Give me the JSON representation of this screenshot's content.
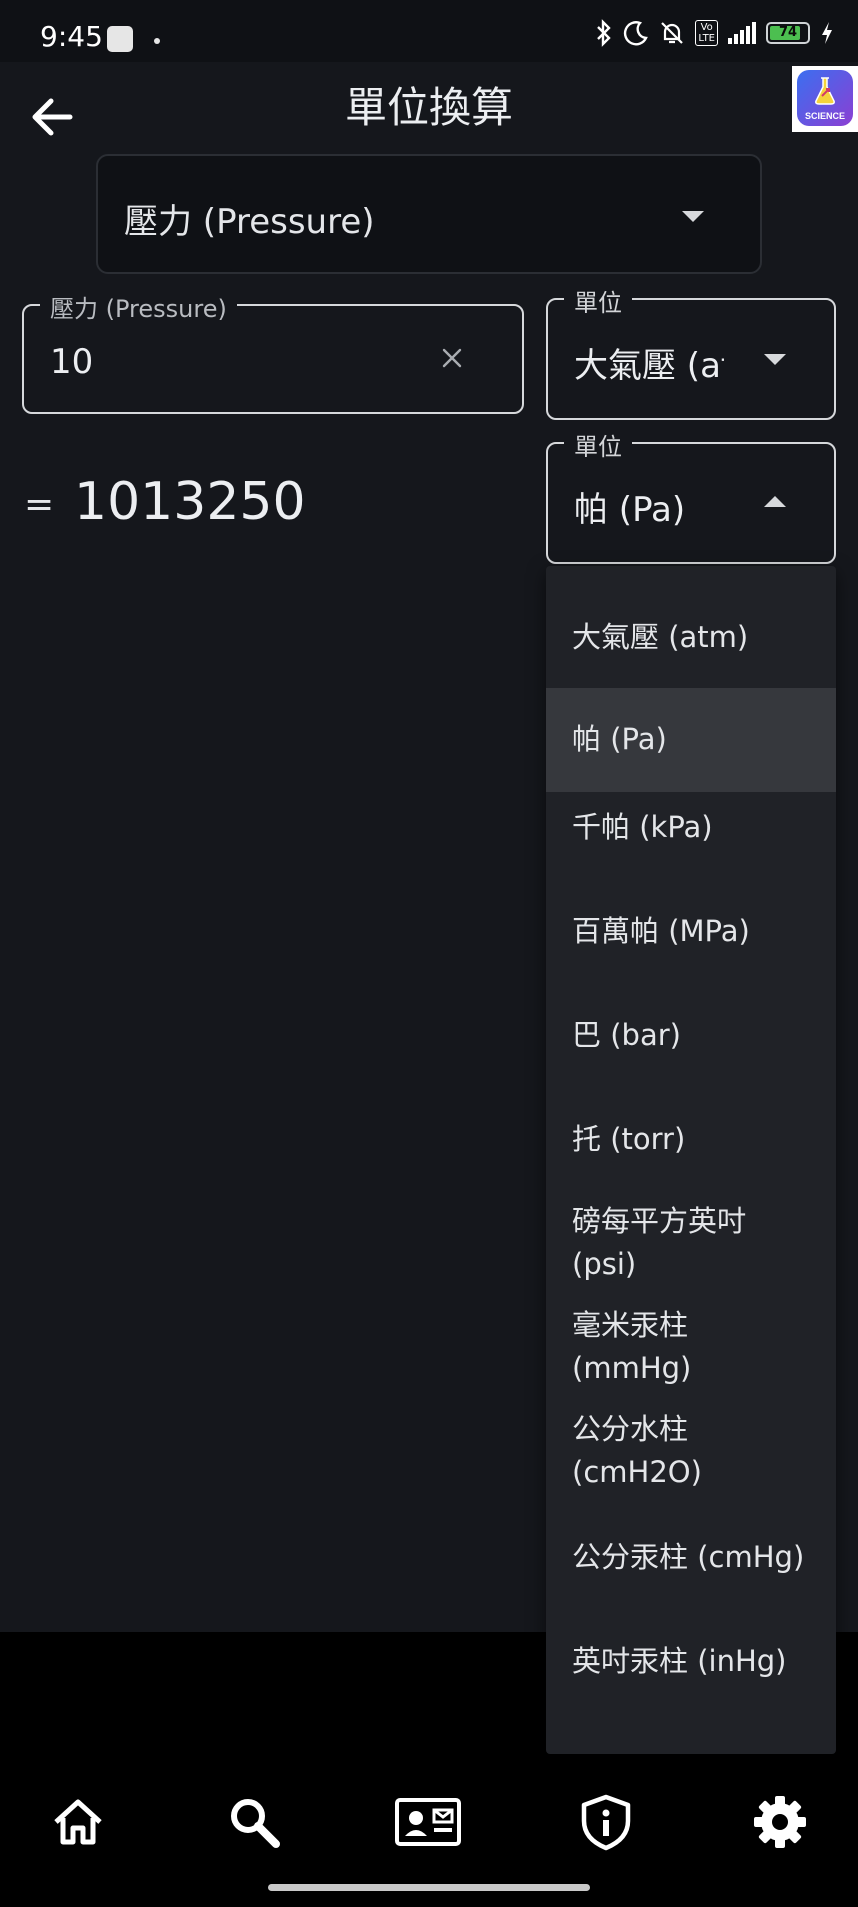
{
  "status_bar": {
    "time": "9:45",
    "battery": "74",
    "lte_label": "Vo\nLTE"
  },
  "app_bar": {
    "title": "單位換算",
    "logo_text": "SCIENCE"
  },
  "category": {
    "selected": "壓力 (Pressure)"
  },
  "input": {
    "label": "壓力 (Pressure)",
    "value": "10"
  },
  "from_unit": {
    "label": "單位",
    "value": "大氣壓 (atm)"
  },
  "to_unit": {
    "label": "單位",
    "value": "帕 (Pa)"
  },
  "result": {
    "equals": "=",
    "value": "1013250"
  },
  "unit_menu": {
    "selected_index": 1,
    "items": [
      [
        "大氣壓 (atm)"
      ],
      [
        "帕 (Pa)"
      ],
      [
        "千帕 (kPa)"
      ],
      [
        "百萬帕 (MPa)"
      ],
      [
        "巴 (bar)"
      ],
      [
        "托 (torr)"
      ],
      [
        "磅每平方英吋",
        "(psi)"
      ],
      [
        "毫米汞柱",
        "(mmHg)"
      ],
      [
        "公分水柱",
        "(cmH2O)"
      ],
      [
        "公分汞柱 (cmHg)"
      ],
      [
        "英吋汞柱 (inHg)"
      ]
    ]
  },
  "bottom_nav": [
    "home-icon",
    "search-icon",
    "contact-card-icon",
    "shield-info-icon",
    "settings-icon"
  ],
  "colors": {
    "background": "#15171c",
    "menu_background": "#202227",
    "menu_selected": "#36383d",
    "battery_fill": "#4cbf50"
  }
}
